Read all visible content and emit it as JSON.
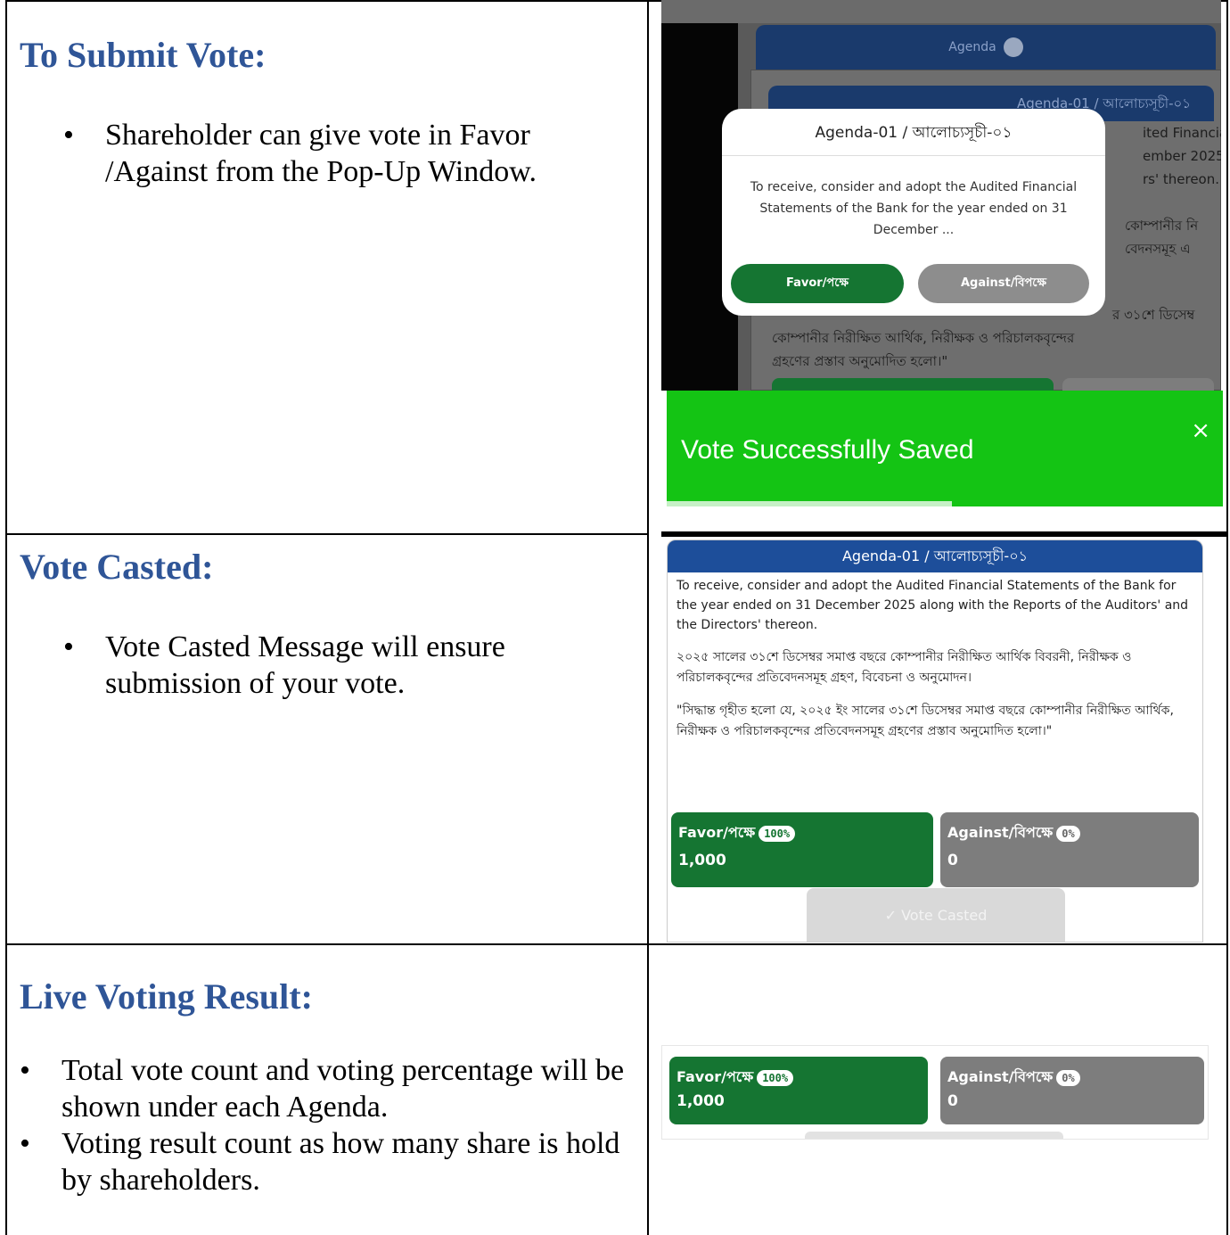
{
  "sections": [
    {
      "heading": "To Submit Vote:",
      "bullets": [
        "Shareholder can give vote in Favor /Against from the Pop-Up Window."
      ]
    },
    {
      "heading": "Vote Casted:",
      "bullets": [
        "Vote Casted Message will ensure submission of your vote."
      ]
    },
    {
      "heading": "Live Voting Result:",
      "bullets": [
        "Total vote count and voting percentage will be shown under each Agenda.",
        "Voting result count as how many share is hold by shareholders."
      ]
    }
  ],
  "popup_screenshot": {
    "agenda_bar": "Agenda",
    "panel_header": "Agenda-01 / আলোচ্যসূচী-০১",
    "background_lines": [
      "ited Financial",
      "ember 2025",
      "rs' thereon.",
      "কোম্পানীর নি",
      "বেদনসমূহ এ",
      "র ৩১শে ডিসেম্ব",
      "কোম্পানীর নিরীক্ষিত আর্থিক, নিরীক্ষক ও পরিচালকবৃন্দের",
      "গ্রহণের প্রস্তাব অনুমোদিত হলো।\""
    ],
    "popup_title": "Agenda-01 / আলোচ্যসূচী-০১",
    "popup_body": "To receive, consider and adopt the Audited Financial Statements of the Bank for the year ended on 31 December ...",
    "favor_button": "Favor/পক্ষে",
    "against_button": "Against/বিপক্ষে"
  },
  "toast": {
    "message": "Vote Successfully Saved",
    "close": "×"
  },
  "agenda_card": {
    "header": "Agenda-01 / আলোচ্যসূচী-০১",
    "english": "To receive, consider and adopt the Audited Financial Statements of the Bank for the year ended on 31 December 2025 along with the Reports of the Auditors' and the Directors' thereon.",
    "bangla_1": "২০২৫ সালের ৩১শে ডিসেম্বর সমাপ্ত বছরে কোম্পানীর নিরীক্ষিত আর্থিক বিবরনী, নিরীক্ষক ও পরিচালকবৃন্দের প্রতিবেদনসমূহ গ্রহণ, বিবেচনা ও অনুমোদন।",
    "bangla_2": "\"সিদ্ধান্ত গৃহীত হলো যে, ২০২৫ ইং সালের ৩১শে ডিসেম্বর সমাপ্ত বছরে কোম্পানীর নিরীক্ষিত আর্থিক, নিরীক্ষক ও পরিচালকবৃন্দের প্রতিবেদনসমূহ গ্রহণের প্রস্তাব অনুমোদিত হলো।\"",
    "favor_label": "Favor/পক্ষে",
    "favor_pct": "100%",
    "favor_count": "1,000",
    "against_label": "Against/বিপক্ষে",
    "against_pct": "0%",
    "against_count": "0",
    "cast_button": "✓ Vote Casted"
  },
  "live_result": {
    "favor_label": "Favor/পক্ষে",
    "favor_pct": "100%",
    "favor_count": "1,000",
    "against_label": "Against/বিপক্ষে",
    "against_pct": "0%",
    "against_count": "0"
  },
  "colors": {
    "heading": "#2F5597",
    "favor": "#157532",
    "against": "#7d7d7d",
    "toast": "#14c414",
    "agenda_header": "#1d4e9a"
  }
}
